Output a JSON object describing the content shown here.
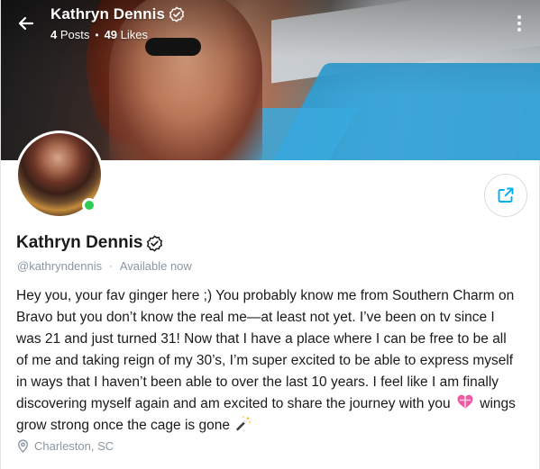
{
  "header": {
    "name": "Kathryn Dennis",
    "posts_count": "4",
    "posts_label": "Posts",
    "likes_count": "49",
    "likes_label": "Likes",
    "separator": "•"
  },
  "profile": {
    "name": "Kathryn Dennis",
    "handle": "@kathryndennis",
    "separator": "·",
    "status": "Available now",
    "status_color": "#2ecc55",
    "verified": true,
    "bio_lines": [
      "Hey you, your fav ginger here ;) You probably know me from Southern Charm on",
      "Bravo but you don’t know the real me—at least not yet. I’ve been on tv since I",
      "was 21 and just turned 31! Now that I have a place where I can be free to be all",
      "of me and taking reign of my 30’s, I’m super excited to be able to express myself",
      "in ways that I haven’t been able to over the last 10 years. I feel like I am finally",
      "discovering myself again and am excited to share the journey with you",
      "wings",
      "grow strong once the cage is gone"
    ],
    "location": "Charleston, SC"
  },
  "icons": {
    "back": "arrow-left-icon",
    "more": "more-vertical-icon",
    "verified": "verified-badge-icon",
    "share": "share-icon",
    "location": "location-pin-icon",
    "heart_emoji": "gift-heart-emoji",
    "wand_emoji": "magic-wand-emoji"
  },
  "colors": {
    "accent": "#00aff0",
    "muted_text": "#8a96a3",
    "online": "#2ecc55"
  }
}
